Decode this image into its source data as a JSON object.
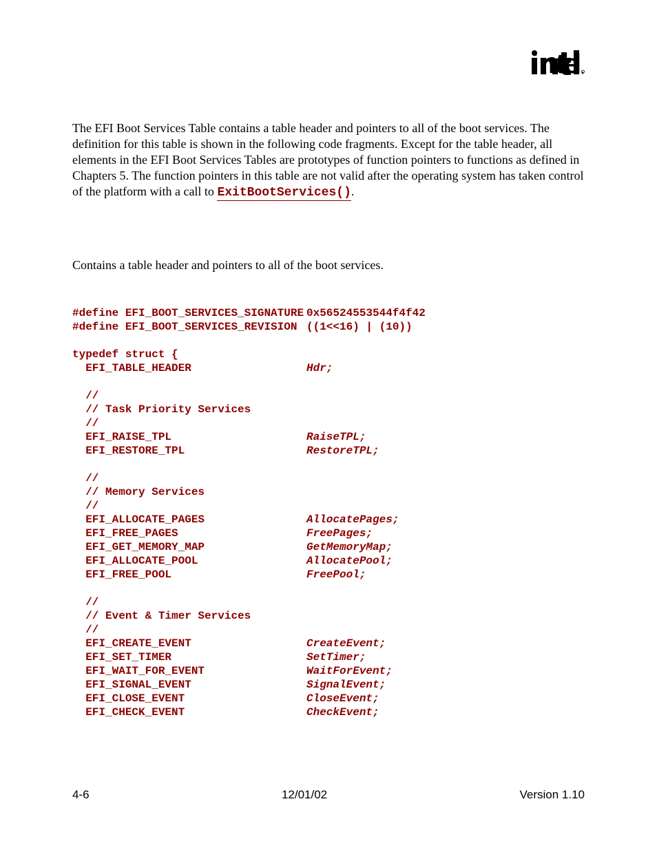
{
  "paragraph": {
    "pre": "The EFI Boot Services Table contains a table header and pointers to all of the boot services.  The definition for this table is shown in the following code fragments.  Except for the table header, all elements in the EFI Boot Services Tables are prototypes of function pointers to functions as defined in Chapters 5.  The function pointers in this table are not valid after the operating system has taken control of the platform with a call to ",
    "link": "ExitBootServices()",
    "post": "."
  },
  "description": "Contains a table header and pointers to all of the boot services.",
  "defines": [
    {
      "name": "#define EFI_BOOT_SERVICES_SIGNATURE",
      "value": "0x56524553544f4f42"
    },
    {
      "name": "#define EFI_BOOT_SERVICES_REVISION",
      "value": "((1<<16) | (10))"
    }
  ],
  "struct_open": "typedef struct {",
  "sections": [
    {
      "comment": null,
      "entries": [
        {
          "type": "  EFI_TABLE_HEADER",
          "name": "Hdr;"
        }
      ]
    },
    {
      "comment": "Task Priority Services",
      "entries": [
        {
          "type": "  EFI_RAISE_TPL",
          "name": "RaiseTPL;"
        },
        {
          "type": "  EFI_RESTORE_TPL",
          "name": "RestoreTPL;"
        }
      ]
    },
    {
      "comment": "Memory Services",
      "entries": [
        {
          "type": "  EFI_ALLOCATE_PAGES",
          "name": "AllocatePages;"
        },
        {
          "type": "  EFI_FREE_PAGES",
          "name": "FreePages;"
        },
        {
          "type": "  EFI_GET_MEMORY_MAP",
          "name": "GetMemoryMap;"
        },
        {
          "type": "  EFI_ALLOCATE_POOL",
          "name": "AllocatePool;"
        },
        {
          "type": "  EFI_FREE_POOL",
          "name": "FreePool;"
        }
      ]
    },
    {
      "comment": "Event & Timer Services",
      "entries": [
        {
          "type": "  EFI_CREATE_EVENT",
          "name": "CreateEvent;"
        },
        {
          "type": "  EFI_SET_TIMER",
          "name": "SetTimer;"
        },
        {
          "type": "  EFI_WAIT_FOR_EVENT",
          "name": "WaitForEvent;"
        },
        {
          "type": "  EFI_SIGNAL_EVENT",
          "name": "SignalEvent;"
        },
        {
          "type": "  EFI_CLOSE_EVENT",
          "name": "CloseEvent;"
        },
        {
          "type": "  EFI_CHECK_EVENT",
          "name": "CheckEvent;"
        }
      ]
    }
  ],
  "footer": {
    "left": "4-6",
    "center": "12/01/02",
    "right": "Version 1.10"
  }
}
